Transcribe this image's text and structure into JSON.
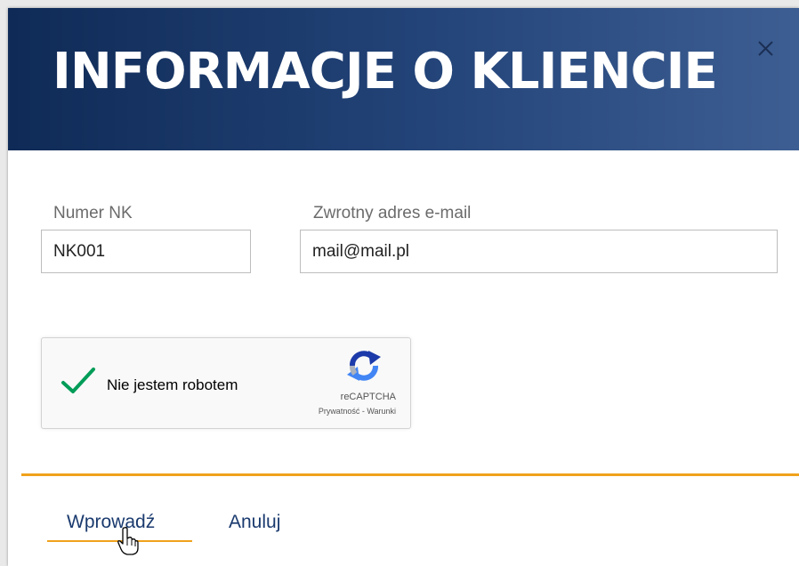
{
  "dialog": {
    "title": "INFORMACJE O KLIENCIE",
    "close_icon": "close-icon"
  },
  "form": {
    "nk": {
      "label": "Numer NK",
      "value": "NK001"
    },
    "email": {
      "label": "Zwrotny adres e-mail",
      "value": "mail@mail.pl"
    }
  },
  "captcha": {
    "label": "Nie jestem robotem",
    "brand": "reCAPTCHA",
    "links": "Prywatność - Warunki",
    "checked": true
  },
  "actions": {
    "submit_label": "Wprowadź",
    "cancel_label": "Anuluj"
  },
  "colors": {
    "header_start": "#0f2a56",
    "header_end": "#3d5e92",
    "accent": "#f0a21c",
    "check": "#009d58",
    "link": "#1a3a6e"
  }
}
